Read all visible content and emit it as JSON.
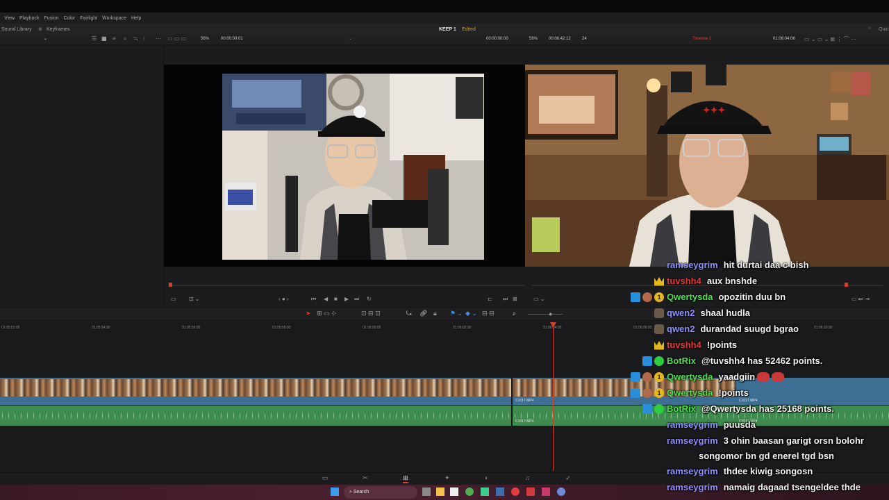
{
  "menu": [
    "View",
    "Playback",
    "Fusion",
    "Color",
    "Fairlight",
    "Workspace",
    "Help"
  ],
  "toolbar1": {
    "sound_library": "Sound Library",
    "keyframes": "Keyframes",
    "project_name": "KEEP 1",
    "project_status": "Edited"
  },
  "source_viewer": {
    "zoom": "56%",
    "timecode": "00:00:00:01"
  },
  "program_viewer": {
    "left_timecode": "00:00:00:00",
    "zoom": "56%",
    "duration": "00:06:42:12",
    "frames": "24",
    "timeline_name": "Timeline 1",
    "timecode": "01:06:04:06"
  },
  "ruler": [
    "01:05:52:00",
    "01:05:54:00",
    "01:05:56:00",
    "01:05:58:00",
    "01:06:00:00",
    "01:06:02:00",
    "01:06:04:00",
    "01:06:06:00",
    "01:06:08:00",
    "01:06:10:00"
  ],
  "clips": {
    "name": "C1017.MP4"
  },
  "taskbar": {
    "search": "Search"
  },
  "chat": [
    {
      "user": "ramseygrim",
      "color": "#8f8fff",
      "badges": [],
      "msg": "hit durtai daa c bish"
    },
    {
      "user": "tuvshh4",
      "color": "#e23b3b",
      "badges": [
        "crown"
      ],
      "msg": "aux bnshde"
    },
    {
      "user": "Qwertysda",
      "color": "#4fe04f",
      "badges": [
        "arrow",
        "face",
        "one"
      ],
      "msg": "opozitin duu bn"
    },
    {
      "user": "qwen2",
      "color": "#8f8fff",
      "badges": [
        "avatar"
      ],
      "msg": "shaal hudla"
    },
    {
      "user": "qwen2",
      "color": "#8f8fff",
      "badges": [
        "avatar"
      ],
      "msg": "durandad suugd bgrao"
    },
    {
      "user": "tuvshh4",
      "color": "#e23b3b",
      "badges": [
        "crown"
      ],
      "msg": "!points"
    },
    {
      "user": "BotRix",
      "color": "#4fe04f",
      "badges": [
        "arrow",
        "verified"
      ],
      "msg": "@tuvshh4 has 52462 points."
    },
    {
      "user": "Qwertysda",
      "color": "#4fe04f",
      "badges": [
        "arrow",
        "face",
        "one"
      ],
      "msg": "yaadgiin"
    },
    {
      "user": "Qwertysda",
      "color": "#4fe04f",
      "badges": [
        "arrow",
        "face",
        "one"
      ],
      "msg": "!points"
    },
    {
      "user": "BotRix",
      "color": "#4fe04f",
      "badges": [
        "arrow",
        "verified"
      ],
      "msg": "@Qwertysda has 25168 points."
    },
    {
      "user": "ramseygrim",
      "color": "#8f8fff",
      "badges": [],
      "msg": "puusda"
    },
    {
      "user": "ramseygrim",
      "color": "#8f8fff",
      "badges": [],
      "msg": "3 ohin baasan garigt orsn bolohr"
    },
    {
      "user": "",
      "color": "#8f8fff",
      "badges": [],
      "msg": "songomor bn gd enerel tgd bsn"
    },
    {
      "user": "ramseygrim",
      "color": "#8f8fff",
      "badges": [],
      "msg": "thdee kiwig songosn"
    },
    {
      "user": "ramseygrim",
      "color": "#8f8fff",
      "badges": [],
      "msg": "namaig dagaad tsengeldee thde"
    }
  ]
}
